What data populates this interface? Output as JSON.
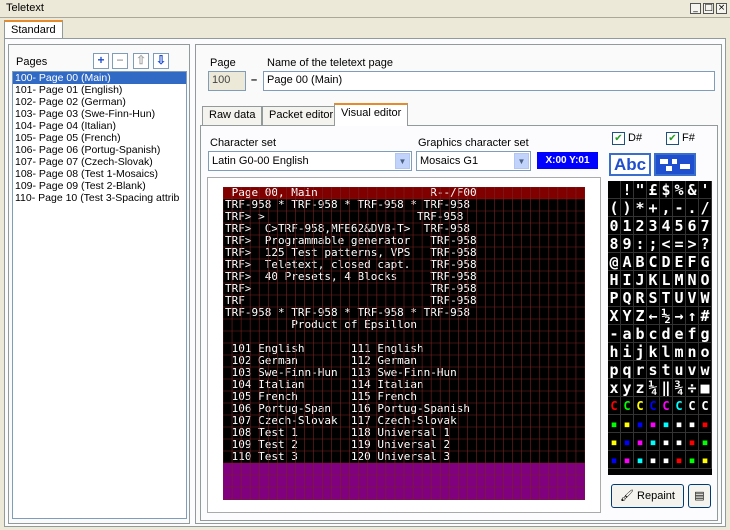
{
  "window": {
    "title": "Teletext"
  },
  "tabs": [
    "Standard"
  ],
  "pages_panel": {
    "title": "Pages",
    "items": [
      "100- Page 00 (Main)",
      "101- Page 01 (English)",
      "102- Page 02 (German)",
      "103- Page 03 (Swe-Finn-Hun)",
      "104- Page 04 (Italian)",
      "105- Page 05 (French)",
      "106- Page 06 (Portug-Spanish)",
      "107- Page 07 (Czech-Slovak)",
      "108- Page 08 (Test 1-Mosaics)",
      "109- Page 09 (Test 2-Blank)",
      "110- Page 10 (Test 3-Spacing attrib"
    ],
    "selected_index": 0,
    "buttons": {
      "add": "+",
      "remove": "−",
      "up": "⇧",
      "down": "⇩"
    }
  },
  "editor": {
    "page_label": "Page",
    "page_value": "100",
    "name_label": "Name of the teletext page",
    "name_value": "Page 00 (Main)",
    "dash": "–",
    "subtabs": [
      "Raw data",
      "Packet editor",
      "Visual editor"
    ],
    "active_subtab": 2,
    "charset_label": "Character set",
    "charset_value": "Latin G0-00 English",
    "gcharset_label": "Graphics character set",
    "gcharset_value": "Mosaics G1",
    "coords": "X:00 Y:01",
    "d_label": "D#",
    "f_label": "F#",
    "abc_label": "Abc",
    "repaint_label": "Repaint"
  },
  "teletext": {
    "header": " Page 00, Main                 R--/F00",
    "rows": [
      "TRF-958 * TRF-958 * TRF-958 * TRF-958",
      "TRF> >                       TRF-958",
      "TRF>  C>TRF-958,MFE62&DVB-T>  TRF-958",
      "TRF>  Programmable generator   TRF-958",
      "TRF>  125 Test patterns, VPS   TRF-958",
      "TRF>  Teletext, closed capt.   TRF-958",
      "TRF>  40 Presets, 4 Blocks     TRF-958",
      "TRF>                           TRF-958",
      "TRF                            TRF-958",
      "TRF-958 * TRF-958 * TRF-958 * TRF-958",
      "          Product of Epsillon",
      "",
      " 101 English       111 English",
      " 102 German        112 German",
      " 103 Swe-Finn-Hun  113 Swe-Finn-Hun",
      " 104 Italian       114 Italian",
      " 105 French        115 French",
      " 106 Portug-Span   116 Portug-Spanish",
      " 107 Czech-Slovak  117 Czech-Slovak",
      " 108 Test 1        118 Universal 1",
      " 109 Test 2        119 Universal 2",
      " 110 Test 3        120 Universal 3"
    ]
  },
  "charmap": [
    " !\"£$%&'",
    "()*+,-./",
    "01234567",
    "89:;<=>?",
    "@ABCDEFG",
    "HIJKLMNO",
    "PQRSTUVW",
    "XYZ←½→↑#",
    "-abcdefg",
    "hijklmno",
    "pqrstuvw",
    "xyz¼‖¾÷■"
  ],
  "colors": {
    "selection": "#316ac5",
    "coords_bg": "#0000ff",
    "header_bg": "#800000",
    "bottom_bg": "#800080"
  }
}
